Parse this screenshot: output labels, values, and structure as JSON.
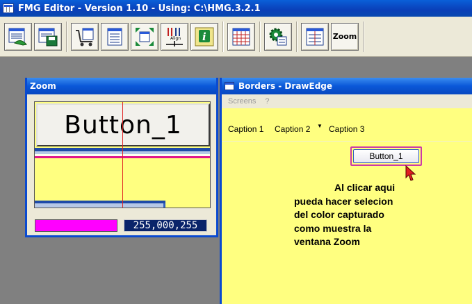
{
  "app": {
    "title": "FMG Editor - Version  1.10 - Using: C:\\HMG.3.2.1"
  },
  "toolbar": {
    "zoom_label": "Zoom"
  },
  "zoom_window": {
    "title": "Zoom",
    "preview_button_label": "Button_1",
    "captured_color": "#ff00ff",
    "captured_color_value": "255,000,255"
  },
  "borders_window": {
    "title": "Borders - DrawEdge",
    "menu": [
      "Screens",
      "?"
    ],
    "tabs": [
      "Caption 1",
      "Caption 2",
      "Caption 3"
    ],
    "button_label": "Button_1",
    "note_lines": [
      "Al clicar aqui",
      "pueda hacer selecion",
      "del color capturado",
      "como muestra la",
      "ventana Zoom"
    ]
  },
  "colors": {
    "titlebar": "#0a4ad0",
    "client_background": "#ffff80",
    "highlight": "#e0148c"
  }
}
